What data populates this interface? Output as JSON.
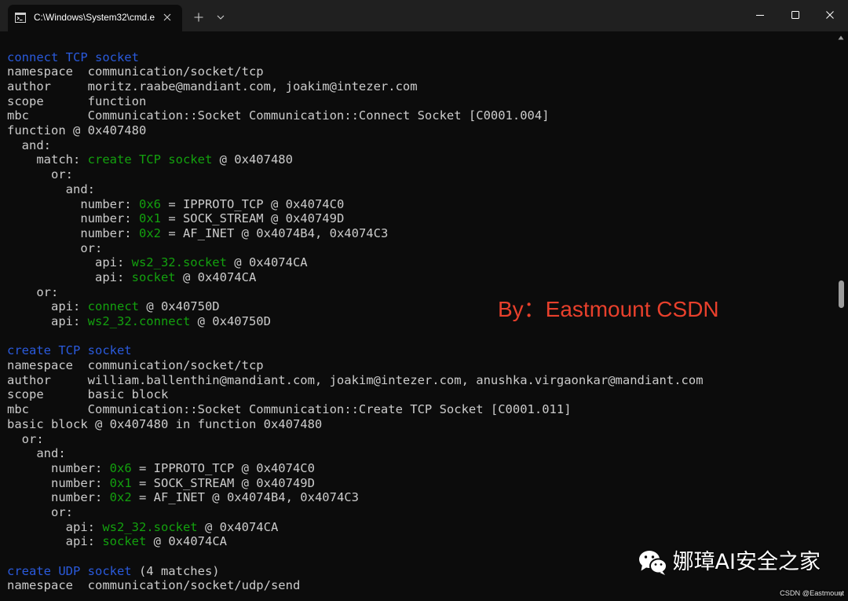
{
  "window": {
    "tab": {
      "title": "C:\\Windows\\System32\\cmd.e",
      "icon": "cmd-icon",
      "close_icon": "close-icon"
    },
    "new_tab_icon": "plus-icon",
    "dropdown_icon": "chevron-down-icon",
    "caption_icons": [
      "minimize-icon",
      "maximize-icon",
      "close-icon"
    ]
  },
  "colors": {
    "titlebar": "#202020",
    "background": "#0c0c0c",
    "foreground": "#cccccc",
    "blue": "#2a5adc",
    "green": "#13a10e",
    "watermark_red": "#e8402c"
  },
  "terminal": {
    "lines": [
      [
        {
          "text": "connect TCP socket",
          "color": "blue"
        }
      ],
      [
        {
          "text": "namespace  communication/socket/tcp"
        }
      ],
      [
        {
          "text": "author     moritz.raabe@mandiant.com, joakim@intezer.com"
        }
      ],
      [
        {
          "text": "scope      function"
        }
      ],
      [
        {
          "text": "mbc        Communication::Socket Communication::Connect Socket [C0001.004]"
        }
      ],
      [
        {
          "text": "function @ 0x407480"
        }
      ],
      [
        {
          "text": "  and:"
        }
      ],
      [
        {
          "text": "    match: "
        },
        {
          "text": "create TCP socket",
          "color": "green"
        },
        {
          "text": " @ 0x407480"
        }
      ],
      [
        {
          "text": "      or:"
        }
      ],
      [
        {
          "text": "        and:"
        }
      ],
      [
        {
          "text": "          number: "
        },
        {
          "text": "0x6",
          "color": "green"
        },
        {
          "text": " = IPPROTO_TCP @ 0x4074C0"
        }
      ],
      [
        {
          "text": "          number: "
        },
        {
          "text": "0x1",
          "color": "green"
        },
        {
          "text": " = SOCK_STREAM @ 0x40749D"
        }
      ],
      [
        {
          "text": "          number: "
        },
        {
          "text": "0x2",
          "color": "green"
        },
        {
          "text": " = AF_INET @ 0x4074B4, 0x4074C3"
        }
      ],
      [
        {
          "text": "          or:"
        }
      ],
      [
        {
          "text": "            api: "
        },
        {
          "text": "ws2_32.socket",
          "color": "green"
        },
        {
          "text": " @ 0x4074CA"
        }
      ],
      [
        {
          "text": "            api: "
        },
        {
          "text": "socket",
          "color": "green"
        },
        {
          "text": " @ 0x4074CA"
        }
      ],
      [
        {
          "text": "    or:"
        }
      ],
      [
        {
          "text": "      api: "
        },
        {
          "text": "connect",
          "color": "green"
        },
        {
          "text": " @ 0x40750D"
        }
      ],
      [
        {
          "text": "      api: "
        },
        {
          "text": "ws2_32.connect",
          "color": "green"
        },
        {
          "text": " @ 0x40750D"
        }
      ],
      [],
      [
        {
          "text": "create TCP socket",
          "color": "blue"
        }
      ],
      [
        {
          "text": "namespace  communication/socket/tcp"
        }
      ],
      [
        {
          "text": "author     william.ballenthin@mandiant.com, joakim@intezer.com, anushka.virgaonkar@mandiant.com"
        }
      ],
      [
        {
          "text": "scope      basic block"
        }
      ],
      [
        {
          "text": "mbc        Communication::Socket Communication::Create TCP Socket [C0001.011]"
        }
      ],
      [
        {
          "text": "basic block @ 0x407480 in function 0x407480"
        }
      ],
      [
        {
          "text": "  or:"
        }
      ],
      [
        {
          "text": "    and:"
        }
      ],
      [
        {
          "text": "      number: "
        },
        {
          "text": "0x6",
          "color": "green"
        },
        {
          "text": " = IPPROTO_TCP @ 0x4074C0"
        }
      ],
      [
        {
          "text": "      number: "
        },
        {
          "text": "0x1",
          "color": "green"
        },
        {
          "text": " = SOCK_STREAM @ 0x40749D"
        }
      ],
      [
        {
          "text": "      number: "
        },
        {
          "text": "0x2",
          "color": "green"
        },
        {
          "text": " = AF_INET @ 0x4074B4, 0x4074C3"
        }
      ],
      [
        {
          "text": "      or:"
        }
      ],
      [
        {
          "text": "        api: "
        },
        {
          "text": "ws2_32.socket",
          "color": "green"
        },
        {
          "text": " @ 0x4074CA"
        }
      ],
      [
        {
          "text": "        api: "
        },
        {
          "text": "socket",
          "color": "green"
        },
        {
          "text": " @ 0x4074CA"
        }
      ],
      [],
      [
        {
          "text": "create UDP socket",
          "color": "blue"
        },
        {
          "text": " (4 matches)"
        }
      ],
      [
        {
          "text": "namespace  communication/socket/udp/send"
        }
      ]
    ]
  },
  "scrollbar": {
    "position": 0.46,
    "up_icon": "triangle-up-icon",
    "down_icon": "triangle-down-icon"
  },
  "watermarks": {
    "author": "By：Eastmount CSDN",
    "wechat_icon": "wechat-icon",
    "account": "娜璋AI安全之家",
    "csdn": "CSDN @Eastmount"
  }
}
